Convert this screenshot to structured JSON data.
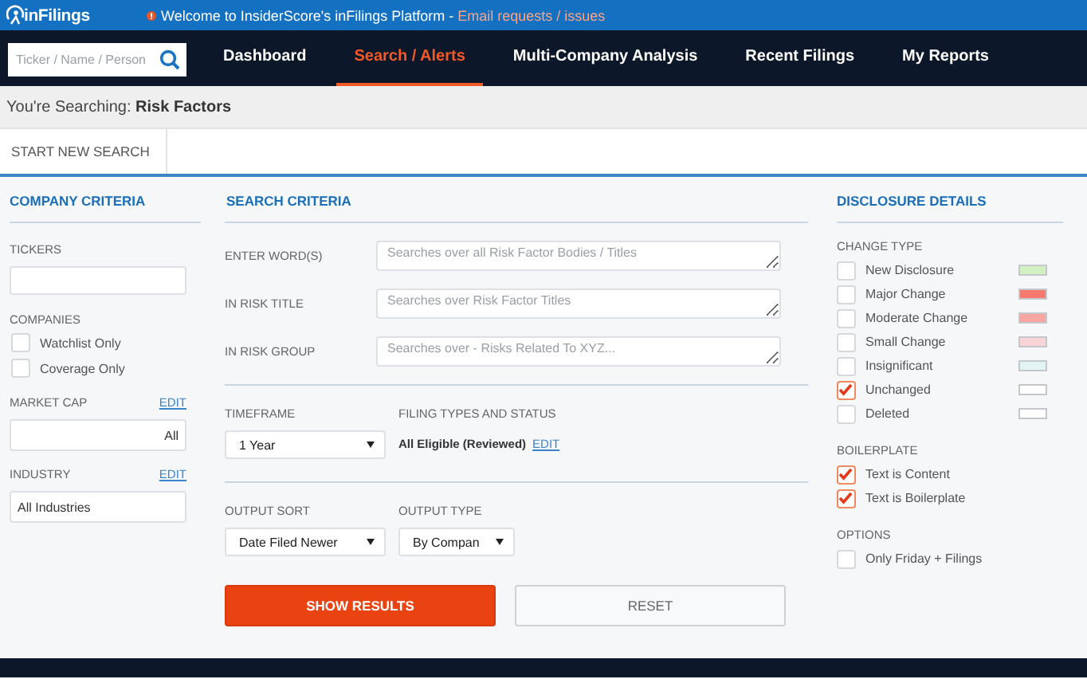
{
  "banner": {
    "logo": "inFilings",
    "message": "Welcome to InsiderScore's inFilings Platform - ",
    "link": "Email requests / issues"
  },
  "nav": {
    "search_placeholder": "Ticker / Name / Person",
    "items": [
      {
        "label": "Dashboard",
        "selected": false
      },
      {
        "label": "Search / Alerts",
        "selected": true
      },
      {
        "label": "Multi-Company Analysis",
        "selected": false
      },
      {
        "label": "Recent Filings",
        "selected": false
      },
      {
        "label": "My Reports",
        "selected": false
      }
    ]
  },
  "searching": {
    "label": "You're Searching:",
    "value": "Risk Factors"
  },
  "toolbar": {
    "button": "START NEW SEARCH"
  },
  "company_criteria": {
    "title": "COMPANY CRITERIA",
    "tickers_label": "TICKERS",
    "companies_label": "COMPANIES",
    "companies": [
      {
        "label": "Watchlist Only",
        "checked": false
      },
      {
        "label": "Coverage Only",
        "checked": false
      }
    ],
    "market_cap": {
      "label": "MARKET CAP",
      "edit": "EDIT",
      "value": "All"
    },
    "industry": {
      "label": "INDUSTRY",
      "edit": "EDIT",
      "value": "All Industries"
    }
  },
  "search_criteria": {
    "title": "SEARCH CRITERIA",
    "fields": [
      {
        "label": "ENTER WORD(S)",
        "placeholder": "Searches over all Risk Factor Bodies / Titles"
      },
      {
        "label": "IN RISK TITLE",
        "placeholder": "Searches over Risk Factor Titles"
      },
      {
        "label": "IN RISK GROUP",
        "placeholder": "Searches over - Risks Related To XYZ..."
      }
    ],
    "timeframe": {
      "label": "TIMEFRAME",
      "value": "1 Year"
    },
    "filing": {
      "label": "FILING TYPES AND STATUS",
      "value": "All Eligible (Reviewed)",
      "edit": "EDIT"
    },
    "output_sort": {
      "label": "OUTPUT SORT",
      "value": "Date Filed Newer"
    },
    "output_type": {
      "label": "OUTPUT TYPE",
      "value": "By Compan"
    },
    "buttons": [
      {
        "label": "SHOW RESULTS",
        "kind": "primary"
      },
      {
        "label": "RESET",
        "kind": "secondary"
      }
    ]
  },
  "disclosure_details": {
    "title": "DISCLOSURE DETAILS",
    "groups": [
      {
        "title": "CHANGE TYPE",
        "items": [
          {
            "label": "New Disclosure",
            "checked": false,
            "color": "#d2f0c2"
          },
          {
            "label": "Major Change",
            "checked": false,
            "color": "#f47a70"
          },
          {
            "label": "Moderate Change",
            "checked": false,
            "color": "#f7a6a1"
          },
          {
            "label": "Small Change",
            "checked": false,
            "color": "#f9d4d7"
          },
          {
            "label": "Insignificant",
            "checked": false,
            "color": "#e3f4f5"
          },
          {
            "label": "Unchanged",
            "checked": true,
            "color": "#ffffff"
          },
          {
            "label": "Deleted",
            "checked": false,
            "color": "#ffffff"
          }
        ]
      },
      {
        "title": "BOILERPLATE",
        "items": [
          {
            "label": "Text is Content",
            "checked": true
          },
          {
            "label": "Text is Boilerplate",
            "checked": true
          }
        ]
      },
      {
        "title": "OPTIONS",
        "items": [
          {
            "label": "Only Friday + Filings",
            "checked": false
          }
        ]
      }
    ]
  }
}
